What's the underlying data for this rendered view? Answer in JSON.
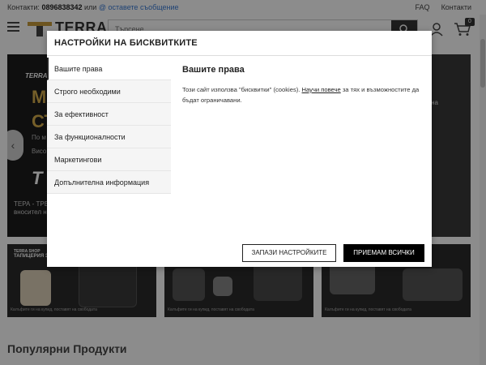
{
  "topbar": {
    "contacts_label": "Контакти:",
    "phone": "0896838342",
    "or": "или",
    "message_link": "@ оставете съобщение",
    "faq": "FAQ",
    "contacts_link": "Контакти"
  },
  "header": {
    "logo_text": "TERRA",
    "search_placeholder": "Търсене...",
    "cart_count": "0"
  },
  "hero": {
    "brand": "TERRA S",
    "line_a": "М",
    "line_b": "СТ",
    "line_c": "По м",
    "line_d": "Висо",
    "line_e": "пасв",
    "big_text": "Т",
    "sub_1": "ТЕРА - ТРЕ",
    "sub_2": "вносител н",
    "side_text": "на"
  },
  "tiles": [
    {
      "brand": "TERRA SHOP",
      "title": "ТАПИЦЕРИЯ З",
      "caption": "Калъфите ги на купид, поставят на свободата"
    },
    {
      "brand": "",
      "title": "",
      "caption": "Калъфите ги на купид, поставят на свободата"
    },
    {
      "brand": "",
      "title": "",
      "caption": "Калъфите ги на купид, поставят на свободата"
    }
  ],
  "section": {
    "popular_title": "Популярни Продукти"
  },
  "modal": {
    "title": "НАСТРОЙКИ НА БИСКВИТКИТЕ",
    "tabs": [
      {
        "label": "Вашите права"
      },
      {
        "label": "Строго необходими"
      },
      {
        "label": "За ефективност"
      },
      {
        "label": "За функционалности"
      },
      {
        "label": "Маркетингови"
      },
      {
        "label": "Допълнителна информация"
      }
    ],
    "content_title": "Вашите права",
    "content_text_before": "Този сайт използва \"бисквитки\" (cookies).",
    "content_link": "Научи повече",
    "content_text_after": "за тях и възможностите да бъдат ограничавани.",
    "save_button": "ЗАПАЗИ НАСТРОЙКИТЕ",
    "accept_button": "ПРИЕМАМ ВСИЧКИ"
  },
  "colors": {
    "accent_gold": "#c79b3b",
    "overlay": "rgba(0,0,0,0.45)",
    "dark": "#000000"
  }
}
